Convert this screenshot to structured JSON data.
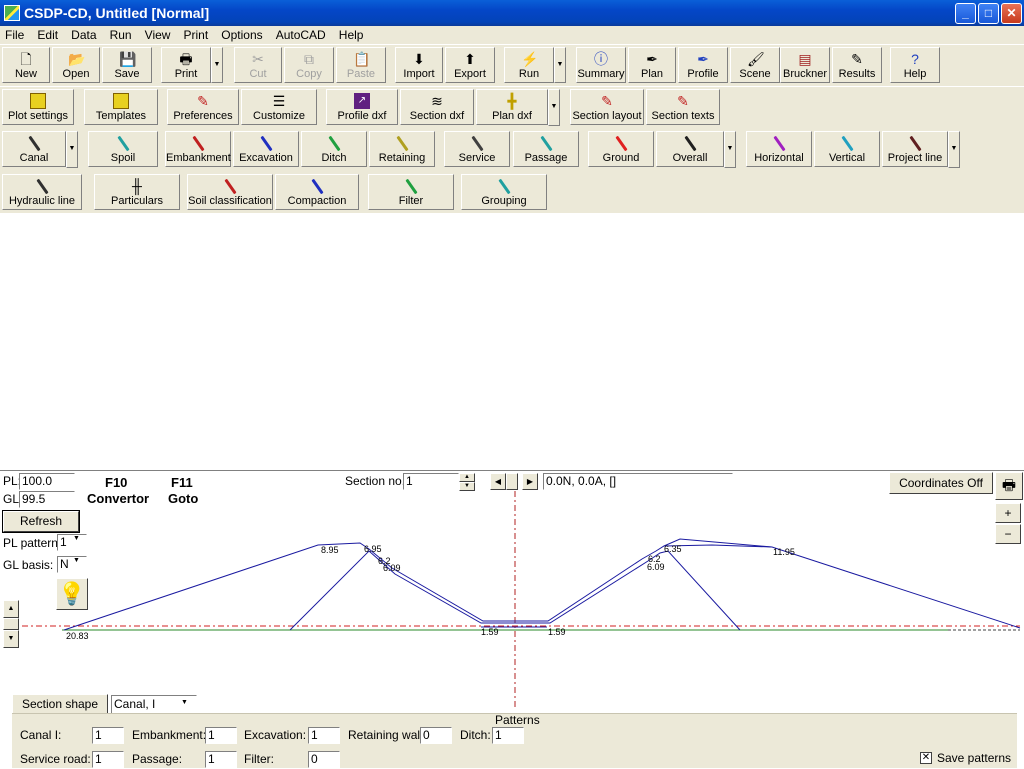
{
  "window": {
    "title": "CSDP-CD, Untitled [Normal]",
    "min": "_",
    "max": "□",
    "close": "✕"
  },
  "menu": [
    "File",
    "Edit",
    "Data",
    "Run",
    "View",
    "Print",
    "Options",
    "AutoCAD",
    "Help"
  ],
  "toolbar1": [
    "New",
    "Open",
    "Save",
    "Print",
    "Cut",
    "Copy",
    "Paste",
    "Import",
    "Export",
    "Run",
    "Summary",
    "Plan",
    "Profile",
    "Scene",
    "Bruckner",
    "Results",
    "Help"
  ],
  "toolbar2": [
    "Plot settings",
    "Templates",
    "Preferences",
    "Customize",
    "Profile dxf",
    "Section dxf",
    "Plan dxf",
    "Section layout",
    "Section texts"
  ],
  "toolbar3": [
    "Canal",
    "Spoil",
    "Embankment",
    "Excavation",
    "Ditch",
    "Retaining",
    "Service",
    "Passage",
    "Ground",
    "Overall",
    "Horizontal",
    "Vertical",
    "Project line"
  ],
  "toolbar4": [
    "Hydraulic line",
    "Particulars",
    "Soil classification",
    "Compaction",
    "Filter",
    "Grouping"
  ],
  "section": {
    "pl_label": "PL:",
    "pl_value": "100.0",
    "gl_label": "GL:",
    "gl_value": "99.5",
    "f10": "F10",
    "f10_text": "Convertor",
    "f11": "F11",
    "f11_text": "Goto",
    "refresh": "Refresh",
    "pl_pattern_label": "PL pattern:",
    "pl_pattern_value": "1",
    "gl_basis_label": "GL basis:",
    "gl_basis_value": "N",
    "section_no_label": "Section no.:",
    "section_no_value": "1",
    "coord_text": "0.0N, 0.0A, []",
    "coordinates_button": "Coordinates Off",
    "zoom_in": "+",
    "zoom_out": "−",
    "section_shape_button": "Section shape",
    "shape_value": "Canal, I",
    "labels": [
      "20.83",
      "8.95",
      "6.95",
      "6.2",
      "6.09",
      "1.59",
      "1.59",
      "6.2",
      "6.09",
      "6.35",
      "11.95"
    ]
  },
  "patterns": {
    "title": "Patterns",
    "canal_label": "Canal I:",
    "canal_value": "1",
    "embankment_label": "Embankment:",
    "embankment_value": "1",
    "excavation_label": "Excavation:",
    "excavation_value": "1",
    "retaining_label": "Retaining wall:",
    "retaining_value": "0",
    "ditch_label": "Ditch:",
    "ditch_value": "1",
    "service_label": "Service road:",
    "service_value": "1",
    "passage_label": "Passage:",
    "passage_value": "1",
    "filter_label": "Filter:",
    "filter_value": "0",
    "save_patterns": "Save patterns"
  }
}
